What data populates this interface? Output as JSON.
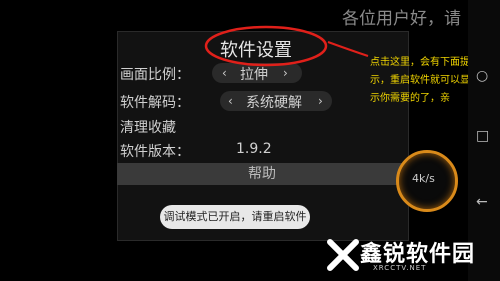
{
  "marquee": "各位用户好，请",
  "dialog": {
    "title": "软件设置",
    "rows": [
      {
        "label": "画面比例：",
        "value": "拉伸"
      },
      {
        "label": "软件解码：",
        "value": "系统硬解"
      },
      {
        "label": "清理收藏",
        "value": ""
      },
      {
        "label": "软件版本：",
        "value": "1.9.2"
      }
    ],
    "help_label": "帮助"
  },
  "toast": "调试模式已开启，请重启软件",
  "annotation": {
    "line1": "点击这里，会有下面提",
    "line2": "示，重启软件就可以显",
    "line3": "示你需要的了，亲"
  },
  "speed": "4k/s",
  "watermark": {
    "name": "鑫锐软件园",
    "url": "XRCCTV.NET"
  },
  "colors": {
    "annotation_red": "#e0201a",
    "annotation_yellow": "#f0d400",
    "ring_orange": "#d98a1a"
  }
}
